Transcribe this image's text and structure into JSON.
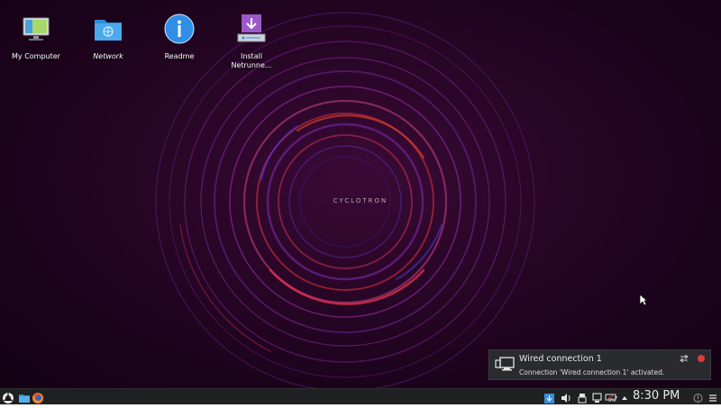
{
  "wallpaper": {
    "text": "CYCLOTRON"
  },
  "desktop_icons": [
    {
      "label": "My Computer",
      "icon": "computer-icon"
    },
    {
      "label": "Network",
      "icon": "network-folder-icon"
    },
    {
      "label": "Readme",
      "icon": "info-icon"
    },
    {
      "label": "Install\nNetrunne...",
      "line1": "Install",
      "line2": "Netrunne...",
      "icon": "install-icon"
    }
  ],
  "notification": {
    "title": "Wired connection 1",
    "body": "Connection 'Wired connection 1' activated.",
    "icon": "network-wired-icon"
  },
  "taskbar": {
    "launcher_icon": "app-launcher-icon",
    "file_manager_icon": "folder-icon",
    "browser_icon": "firefox-icon",
    "tray": {
      "clock": "8:30 PM",
      "battery_text": "3%"
    }
  },
  "colors": {
    "taskbar_bg": "#1f2022",
    "notification_bg": "#2a2b2e",
    "close_red": "#e03a3a",
    "tray_blue": "#3b8ed9"
  }
}
